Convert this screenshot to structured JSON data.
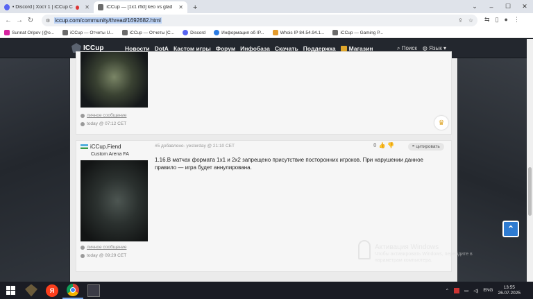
{
  "browser": {
    "tabs": [
      {
        "title": "• Discord | Хост 1 | iCCup Cu",
        "active": false,
        "icon": "discord-icon"
      },
      {
        "title": "iCCup — [1x1 rftd] keo vs glad",
        "active": true,
        "icon": "iccup-icon"
      }
    ],
    "url": "iccup.com/community/thread/1692682.html",
    "bookmarks": [
      {
        "label": "Sunnat Oripov (@o...",
        "icon": "instagram-icon"
      },
      {
        "label": "iCCup — Отчеты U...",
        "icon": "iccup-icon"
      },
      {
        "label": "iCCup — Отчеты [C...",
        "icon": "iccup-icon"
      },
      {
        "label": "Discord",
        "icon": "discord-icon"
      },
      {
        "label": "Информация об IP...",
        "icon": "globe-icon"
      },
      {
        "label": "Whois IP 84.54.94.1...",
        "icon": "bookmark-icon"
      },
      {
        "label": "iCCup — Gaming P...",
        "icon": "iccup-icon"
      }
    ]
  },
  "site": {
    "logo": "ICCup",
    "menu": [
      "Новости",
      "DotA",
      "Кастом игры",
      "Форум",
      "Инфобаза",
      "Скачать",
      "Поддержка",
      "Магазин"
    ],
    "search": "Поиск",
    "language": "Язык"
  },
  "posts": [
    {
      "pm": "личное сообщение",
      "time": "today @ 07:12 СЕТ"
    },
    {
      "username": "iCCup.Fiend",
      "user_title": "Custom Arena FA",
      "info": "#5 добавлено- yesterday @ 21:10 СЕТ",
      "votes": "0",
      "quote": "цитировать",
      "text": "1.16.В матчах формата 1x1 и 2x2 запрещено присутствие посторонних игроков. При нарушении данное правило — игра будет аннулирована.",
      "pm": "личное сообщение",
      "time": "today @ 09:29 СЕТ"
    }
  ],
  "watermark": {
    "title": "Активация Windows",
    "line1": "Чтобы активировать Windows, перейдите в",
    "line2": "параметрам компьютера."
  },
  "taskbar": {
    "lang": "ENG",
    "time": "13:55",
    "date": "26.07.2025"
  },
  "colors": {
    "accent": "#2e7bd1",
    "gold": "#e0a72b"
  }
}
